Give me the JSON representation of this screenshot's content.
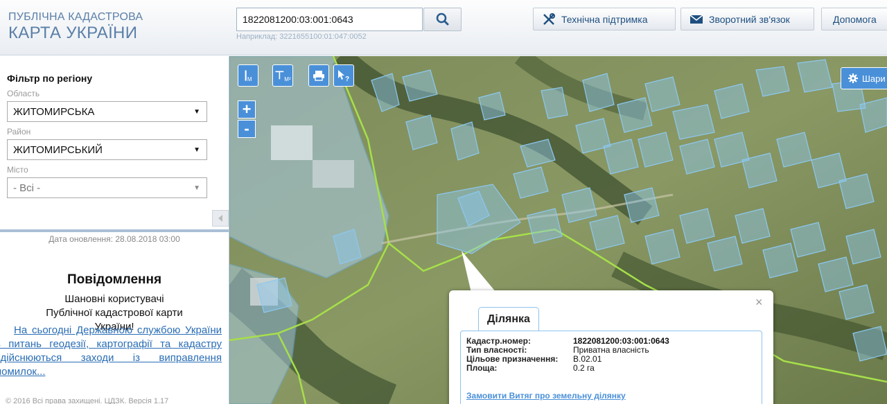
{
  "header": {
    "logo_line1": "ПУБЛІЧНА КАДАСТРОВА",
    "logo_line2": "КАРТА УКРАЇНИ",
    "search_value": "1822081200:03:001:0643",
    "search_hint": "Наприклад: 3221655100:01:047:0052",
    "buttons": {
      "support": "Технічна підтримка",
      "feedback": "Зворотний зв'язок",
      "help": "Допомога"
    }
  },
  "sidebar": {
    "filter_title": "Фільтр по регіону",
    "oblast_label": "Область",
    "oblast_value": "ЖИТОМИРСЬКА",
    "rayon_label": "Район",
    "rayon_value": "ЖИТОМИРСЬКИЙ",
    "city_label": "Місто",
    "city_value": "- Всі -",
    "updated": "Дата оновлення: 28.08.2018 03:00",
    "notice_title": "Повідомлення",
    "notice_greeting": "Шановні користувачі Публічної кадастрової карти України!",
    "notice_link": "На сьогодні Державною службою України з питань геодезії, картографії та кадастру здійснюються заходи із виправлення помилок...",
    "copyright": "© 2016 Всі права захищені. ЦДЗК. Версія 1.17"
  },
  "map": {
    "tools": {
      "measure_line": "М",
      "measure_area": "М²"
    },
    "zoom_in": "+",
    "zoom_out": "-",
    "layers_label": "Шари"
  },
  "popup": {
    "close": "×",
    "tab_label": "Ділянка",
    "rows": [
      {
        "key": "Кадастр.номер:",
        "value": "1822081200:03:001:0643"
      },
      {
        "key": "Тип власності:",
        "value": "Приватна власність"
      },
      {
        "key": "Цільове призначення:",
        "value": "В.02.01"
      },
      {
        "key": "Площа:",
        "value": "0.2 га"
      }
    ],
    "order_link": "Замовити Витяг про земельну ділянку"
  },
  "colors": {
    "accent": "#4a90d9",
    "logo": "#5a7fa8",
    "parcel_fill": "#8cc8f0",
    "boundary_line": "#a6e04a"
  },
  "icons": [
    "search-icon",
    "tools-icon",
    "envelope-icon",
    "print-icon",
    "pointer-help-icon",
    "gear-icon",
    "close-icon",
    "chevron-left-icon"
  ]
}
